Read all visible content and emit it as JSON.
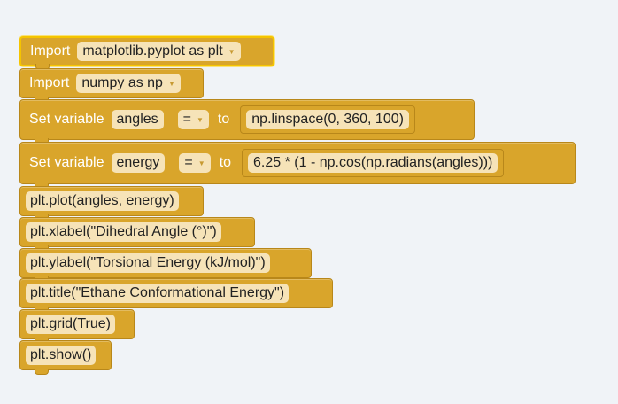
{
  "blocks": {
    "import1": {
      "keyword": "Import",
      "module": "matplotlib.pyplot as plt"
    },
    "import2": {
      "keyword": "Import",
      "module": "numpy as np"
    },
    "set1": {
      "keyword": "Set variable",
      "variable": "angles",
      "operator": "=",
      "to": "to",
      "value": "np.linspace(0, 360, 100)"
    },
    "set2": {
      "keyword": "Set variable",
      "variable": "energy",
      "operator": "=",
      "to": "to",
      "value": "6.25 * (1 - np.cos(np.radians(angles)))"
    },
    "code": [
      "plt.plot(angles, energy)",
      "plt.xlabel(\"Dihedral Angle (°)\")",
      "plt.ylabel(\"Torsional Energy (kJ/mol)\")",
      "plt.title(\"Ethane Conformational Energy\")",
      "plt.grid(True)",
      "plt.show()"
    ]
  },
  "colors": {
    "block": "#d9a52b",
    "field": "#f6e3b8",
    "selected_outline": "#f5c400",
    "background": "#f0f3f7"
  }
}
